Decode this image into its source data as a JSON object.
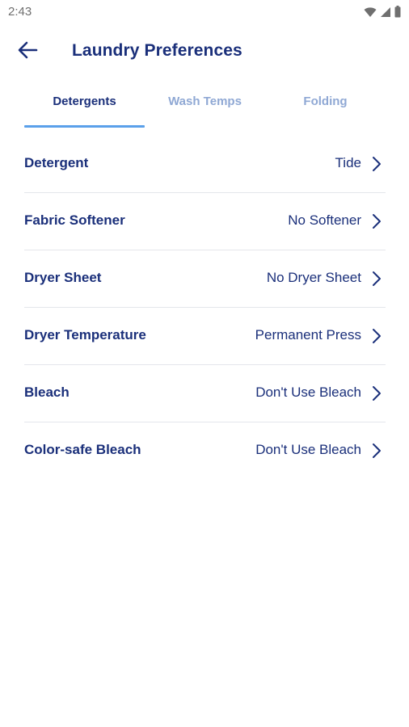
{
  "status_bar": {
    "time": "2:43",
    "icons": [
      "wifi-icon",
      "signal-icon",
      "battery-icon"
    ]
  },
  "app_bar": {
    "back_icon": "arrow-back-icon",
    "title": "Laundry Preferences"
  },
  "tabs": [
    {
      "label": "Detergents",
      "active": true
    },
    {
      "label": "Wash Temps",
      "active": false
    },
    {
      "label": "Folding",
      "active": false
    }
  ],
  "settings": [
    {
      "label": "Detergent",
      "value": "Tide"
    },
    {
      "label": "Fabric Softener",
      "value": "No Softener"
    },
    {
      "label": "Dryer Sheet",
      "value": "No Dryer Sheet"
    },
    {
      "label": "Dryer Temperature",
      "value": "Permanent Press"
    },
    {
      "label": "Bleach",
      "value": "Don't Use Bleach"
    },
    {
      "label": "Color-safe Bleach",
      "value": "Don't Use Bleach"
    }
  ],
  "colors": {
    "primary_text": "#1a2f7a",
    "inactive_tab": "#8fa8d4",
    "tab_indicator": "#5aa0ea",
    "divider": "#e4e6eb"
  }
}
